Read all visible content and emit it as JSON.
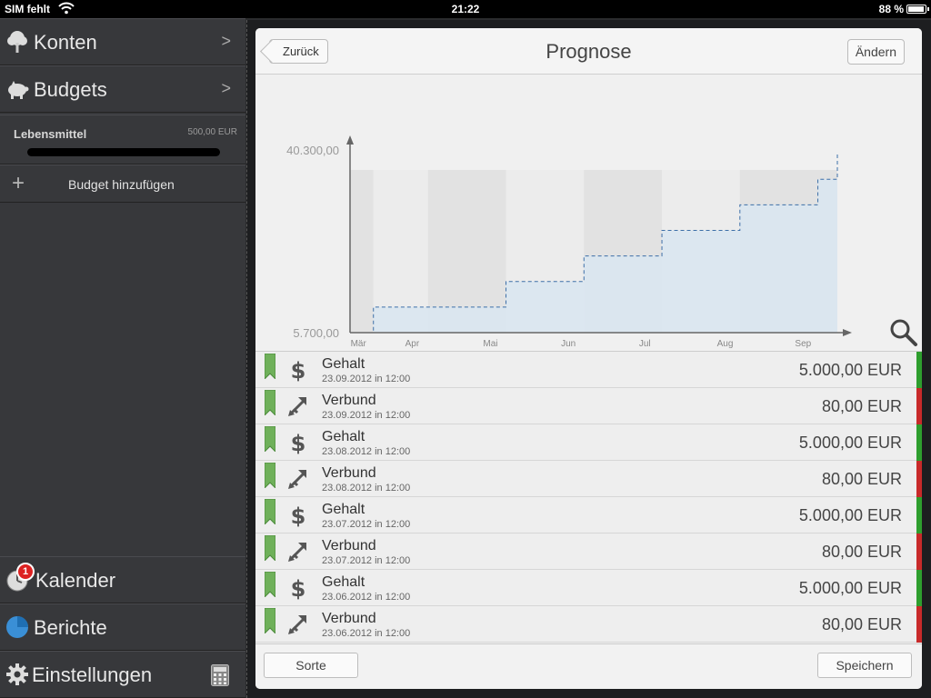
{
  "status_bar": {
    "carrier": "SIM fehlt",
    "time": "21:22",
    "battery": "88 %"
  },
  "sidebar": {
    "konten": "Konten",
    "budgets": "Budgets",
    "budget_items": [
      {
        "name": "Lebensmittel",
        "amount": "500,00 EUR"
      }
    ],
    "add_budget": "Budget hinzufügen",
    "kalender": "Kalender",
    "kalender_badge": "1",
    "berichte": "Berichte",
    "einstellungen": "Einstellungen"
  },
  "navbar": {
    "back": "Zurück",
    "title": "Prognose",
    "edit": "Ändern"
  },
  "chart_data": {
    "type": "area",
    "title": "",
    "xlabel": "",
    "ylabel": "",
    "y_tick_labels": [
      "40.300,00",
      "5.700,00"
    ],
    "ylim": [
      5700,
      40300
    ],
    "categories": [
      "Mär",
      "Apr",
      "Mai",
      "Jun",
      "Jul",
      "Aug",
      "Sep"
    ],
    "x": [
      0,
      0.3,
      1,
      2,
      3,
      4,
      5,
      6,
      6.25
    ],
    "series": [
      {
        "values": [
          5700,
          10540,
          10540,
          15380,
          20220,
          25060,
          29900,
          34740,
          39580
        ]
      }
    ],
    "grid": false
  },
  "transactions": [
    {
      "name": "Gehalt",
      "date": "23.09.2012 in 12:00",
      "amount": "5.000,00 EUR",
      "kind": "income"
    },
    {
      "name": "Verbund",
      "date": "23.09.2012 in 12:00",
      "amount": "80,00 EUR",
      "kind": "expense"
    },
    {
      "name": "Gehalt",
      "date": "23.08.2012 in 12:00",
      "amount": "5.000,00 EUR",
      "kind": "income"
    },
    {
      "name": "Verbund",
      "date": "23.08.2012 in 12:00",
      "amount": "80,00 EUR",
      "kind": "expense"
    },
    {
      "name": "Gehalt",
      "date": "23.07.2012 in 12:00",
      "amount": "5.000,00 EUR",
      "kind": "income"
    },
    {
      "name": "Verbund",
      "date": "23.07.2012 in 12:00",
      "amount": "80,00 EUR",
      "kind": "expense"
    },
    {
      "name": "Gehalt",
      "date": "23.06.2012 in 12:00",
      "amount": "5.000,00 EUR",
      "kind": "income"
    },
    {
      "name": "Verbund",
      "date": "23.06.2012 in 12:00",
      "amount": "80,00 EUR",
      "kind": "expense"
    }
  ],
  "footer": {
    "sort": "Sorte",
    "save": "Speichern"
  },
  "colors": {
    "income": "#2e9e2e",
    "expense": "#c82a2a",
    "tag": "#6fb05a",
    "chart_fill": "#d9e6f1",
    "chart_line": "#3d6fa8"
  },
  "icons": {
    "konten": "tree-icon",
    "budgets": "piggy-bank-icon",
    "kalender": "clock-icon",
    "berichte": "pie-chart-icon",
    "einstellungen": "gear-icon",
    "calculator": "calculator-icon",
    "zoom": "magnifier-icon",
    "income": "dollar-icon",
    "expense": "transfer-arrows-icon"
  }
}
